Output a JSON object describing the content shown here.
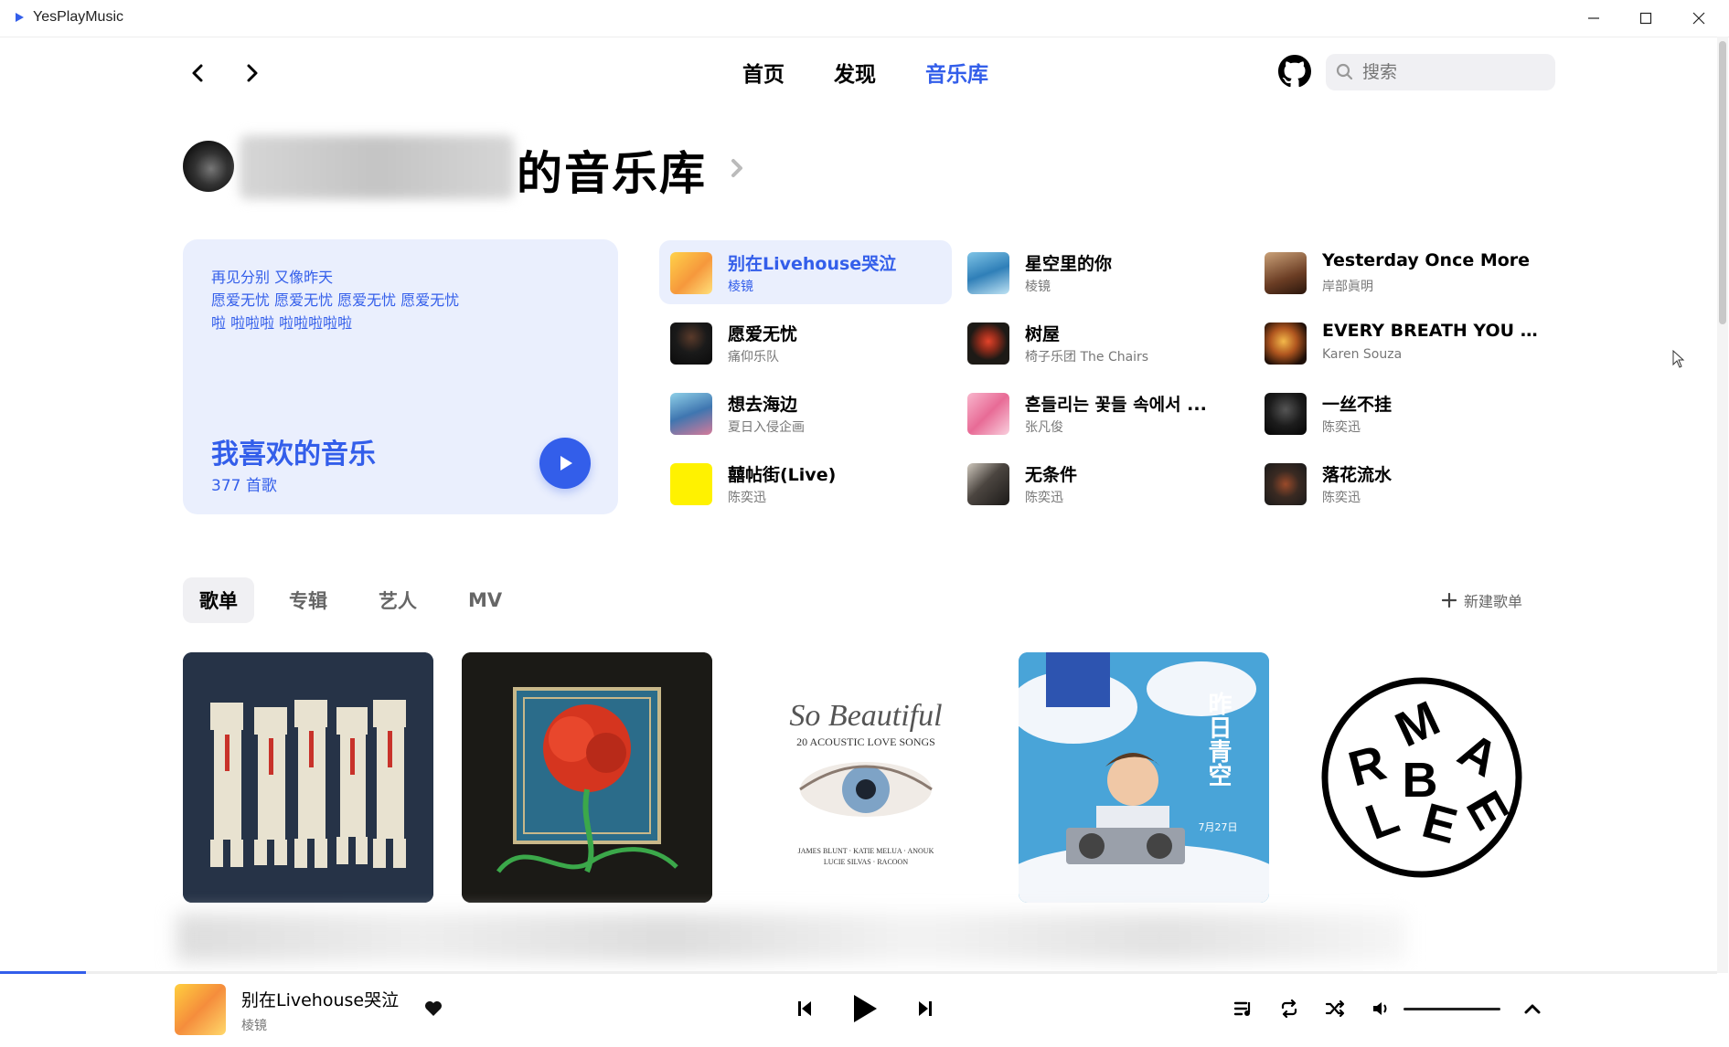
{
  "window": {
    "app_title": "YesPlayMusic"
  },
  "nav": {
    "links": [
      "首页",
      "发现",
      "音乐库"
    ],
    "active_link": "音乐库",
    "search_placeholder": "搜索"
  },
  "library": {
    "title_suffix": "的音乐库"
  },
  "liked": {
    "lyrics": [
      "再见分别 又像昨天",
      "愿爱无忧 愿爱无忧 愿爱无忧 愿爱无忧",
      "啦 啦啦啦 啦啦啦啦啦"
    ],
    "title": "我喜欢的音乐",
    "count": "377 首歌"
  },
  "songs": [
    {
      "title": "别在Livehouse哭泣",
      "artist": "棱镜",
      "active": true
    },
    {
      "title": "星空里的你",
      "artist": "棱镜"
    },
    {
      "title": "Yesterday Once More",
      "artist": "岸部眞明"
    },
    {
      "title": "愿爱无忧",
      "artist": "痛仰乐队"
    },
    {
      "title": "树屋",
      "artist": "椅子乐团 The Chairs"
    },
    {
      "title": "EVERY BREATH YOU T...",
      "artist": "Karen Souza"
    },
    {
      "title": "想去海边",
      "artist": "夏日入侵企画"
    },
    {
      "title": "흔들리는 꽃들 속에서 ...",
      "artist": "张凡俊"
    },
    {
      "title": "一丝不挂",
      "artist": "陈奕迅"
    },
    {
      "title": "囍帖街(Live)",
      "artist": "陈奕迅"
    },
    {
      "title": "无条件",
      "artist": "陈奕迅"
    },
    {
      "title": "落花流水",
      "artist": "陈奕迅"
    }
  ],
  "tabs": [
    "歌单",
    "专辑",
    "艺人",
    "MV"
  ],
  "active_tab": "歌单",
  "new_playlist_label": "新建歌单",
  "playlist_cover_texts": {
    "so_beautiful_title": "So Beautiful",
    "so_beautiful_subtitle": "20 ACOUSTIC LOVE SONGS",
    "so_beautiful_artists_1": "JAMES BLUNT · KATIE MELUA · ANOUK",
    "so_beautiful_artists_2": "LUCIE SILVAS · RACOON",
    "youth_title": "昨日青空",
    "youth_date": "7月27日",
    "logo_letters": [
      "M",
      "A",
      "R",
      "B",
      "L",
      "E",
      "E"
    ]
  },
  "player": {
    "title": "别在Livehouse哭泣",
    "artist": "棱镜",
    "progress": 0.05
  },
  "colors": {
    "accent": "#335eea",
    "card_bg": "#eaeffd"
  }
}
